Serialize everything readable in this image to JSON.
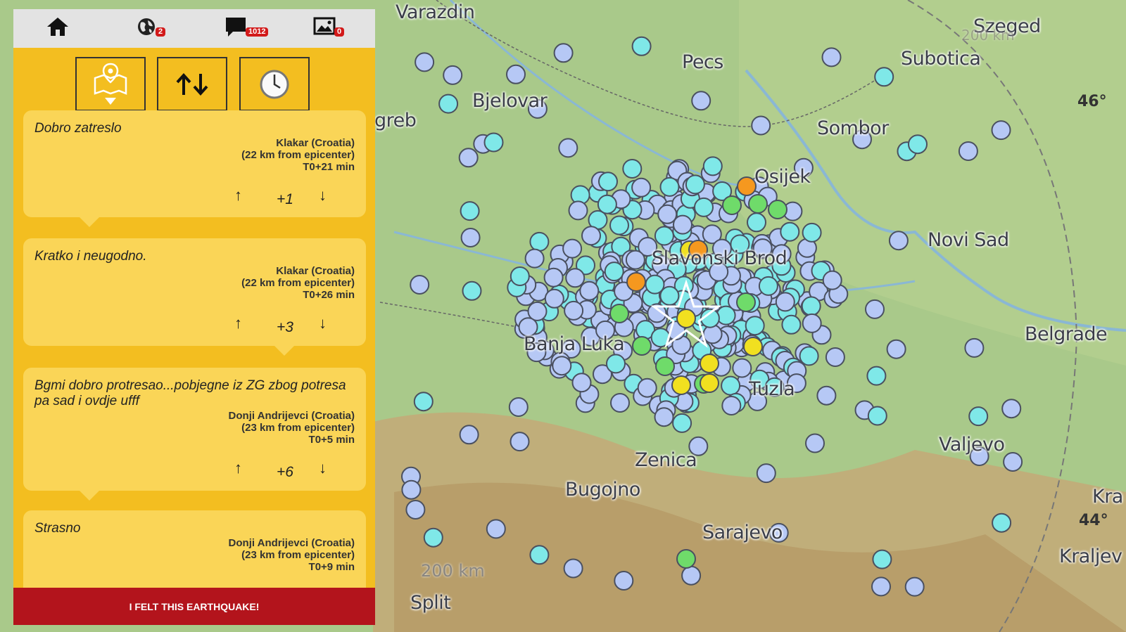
{
  "toolbar_icons": {
    "home": "home-icon",
    "globe": "globe-icon",
    "comments": "comments-icon",
    "photos": "photos-icon"
  },
  "badges": {
    "globe_count": "2",
    "comments_count": "1012",
    "photos_count": "0"
  },
  "filter_buttons": [
    "map-pin-filter-icon",
    "sort-arrows-icon",
    "clock-icon"
  ],
  "comments": [
    {
      "text": "Dobro zatreslo",
      "place": "Klakar (Croatia)",
      "distance": "(22 km from epicenter)",
      "time": "T0+21 min",
      "score": "+1"
    },
    {
      "text": "Kratko i neugodno.",
      "place": "Klakar (Croatia)",
      "distance": "(22 km from epicenter)",
      "time": "T0+26 min",
      "score": "+3"
    },
    {
      "text": "Bgmi dobro protresao...pobjegne iz ZG zbog potresa pa sad i ovdje ufff",
      "place": "Donji Andrijevci (Croatia)",
      "distance": "(23 km from epicenter)",
      "time": "T0+5 min",
      "score": "+6"
    },
    {
      "text": "Strasno",
      "place": "Donji Andrijevci (Croatia)",
      "distance": "(23 km from epicenter)",
      "time": "T0+9 min",
      "score": ""
    }
  ],
  "arrows": {
    "up": "↑",
    "down": "↓"
  },
  "felt_button": "I FELT THIS EARTHQUAKE!",
  "map": {
    "cities": [
      "Varazdin",
      "Szeged",
      "Pecs",
      "Subotica",
      "Bjelovar",
      "greb",
      "Sombor",
      "Osijek",
      "Novi Sad",
      "Slavonski Brod",
      "Banja Luka",
      "Belgrade",
      "Tuzla",
      "Valjevo",
      "Zenica",
      "Bugojno",
      "Sarajevo",
      "Split",
      "Kra",
      "Kraljev"
    ],
    "scale_labels": [
      "200 km",
      "200 km"
    ],
    "lat_labels": [
      "46°",
      "44°"
    ],
    "colors": {
      "intensity_low": "#b6c8f5",
      "intensity_mid": "#7fe8e8",
      "intensity_green": "#6fdb6a",
      "intensity_yellow": "#f1e020",
      "intensity_orange": "#f5981f",
      "epicenter_star": "#ffffff"
    }
  }
}
